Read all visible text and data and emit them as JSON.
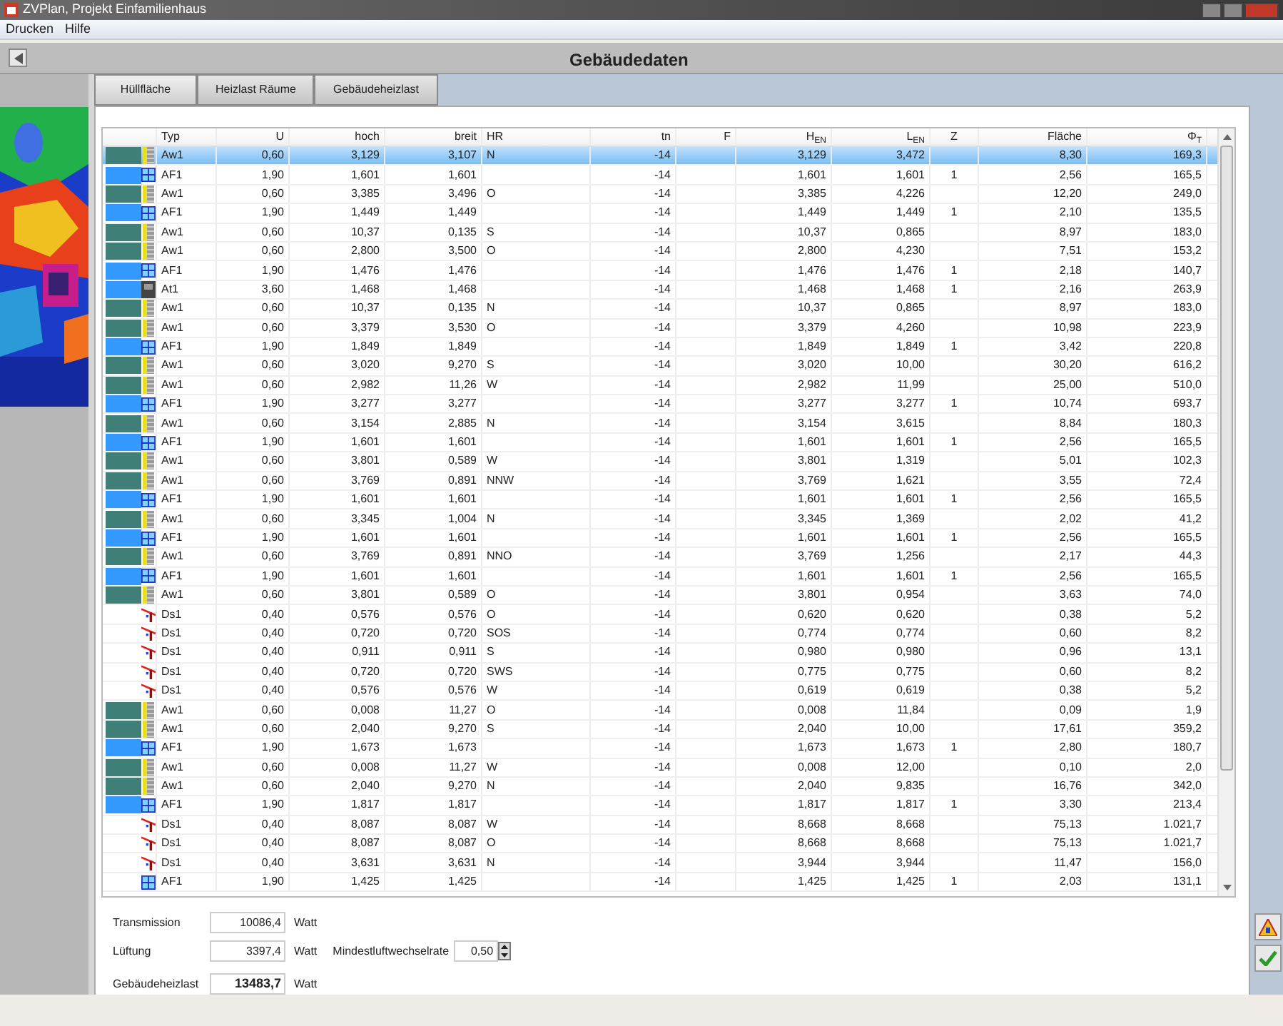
{
  "window": {
    "title": "ZVPlan, Projekt Einfamilienhaus"
  },
  "menu": [
    "Drucken",
    "Hilfe"
  ],
  "header": {
    "title": "Gebäudedaten"
  },
  "sidebar": {
    "picture": {
      "kind": "picture"
    }
  },
  "tabs": [
    {
      "label": "Hüllfläche",
      "selected": true
    },
    {
      "label": "Heizlast Räume",
      "selected": false
    },
    {
      "label": "Gebäudeheizlast",
      "selected": false
    }
  ],
  "table": {
    "columns": [
      "Typ",
      "U",
      "hoch",
      "breit",
      "HR",
      "tn",
      "F",
      "H$_{EN}$",
      "L$_{EN}$",
      "Z",
      "Fläche",
      "Φ$_{T}$"
    ],
    "rows": [
      {
        "kind": "wall",
        "color": "#3f7f78",
        "selected": true,
        "cells": [
          "Aw1",
          "0,60",
          "3,129",
          "3,107",
          "N",
          "-14",
          "",
          "3,129",
          "3,472",
          "",
          "8,30",
          "169,3"
        ]
      },
      {
        "kind": "window",
        "color": "#3399ff",
        "selected": false,
        "cells": [
          "AF1",
          "1,90",
          "1,601",
          "1,601",
          "",
          "-14",
          "",
          "1,601",
          "1,601",
          "1",
          "2,56",
          "165,5"
        ]
      },
      {
        "kind": "wall",
        "color": "#3f7f78",
        "selected": false,
        "cells": [
          "Aw1",
          "0,60",
          "3,385",
          "3,496",
          "O",
          "-14",
          "",
          "3,385",
          "4,226",
          "",
          "12,20",
          "249,0"
        ]
      },
      {
        "kind": "window",
        "color": "#3399ff",
        "selected": false,
        "cells": [
          "AF1",
          "1,90",
          "1,449",
          "1,449",
          "",
          "-14",
          "",
          "1,449",
          "1,449",
          "1",
          "2,10",
          "135,5"
        ]
      },
      {
        "kind": "wall",
        "color": "#3f7f78",
        "selected": false,
        "cells": [
          "Aw1",
          "0,60",
          "10,37",
          "0,135",
          "S",
          "-14",
          "",
          "10,37",
          "0,865",
          "",
          "8,97",
          "183,0"
        ]
      },
      {
        "kind": "wall",
        "color": "#3f7f78",
        "selected": false,
        "cells": [
          "Aw1",
          "0,60",
          "2,800",
          "3,500",
          "O",
          "-14",
          "",
          "2,800",
          "4,230",
          "",
          "7,51",
          "153,2"
        ]
      },
      {
        "kind": "window",
        "color": "#3399ff",
        "selected": false,
        "cells": [
          "AF1",
          "1,90",
          "1,476",
          "1,476",
          "",
          "-14",
          "",
          "1,476",
          "1,476",
          "1",
          "2,18",
          "140,7"
        ]
      },
      {
        "kind": "door",
        "color": "#3399ff",
        "selected": false,
        "cells": [
          "At1",
          "3,60",
          "1,468",
          "1,468",
          "",
          "-14",
          "",
          "1,468",
          "1,468",
          "1",
          "2,16",
          "263,9"
        ]
      },
      {
        "kind": "wall",
        "color": "#3f7f78",
        "selected": false,
        "cells": [
          "Aw1",
          "0,60",
          "10,37",
          "0,135",
          "N",
          "-14",
          "",
          "10,37",
          "0,865",
          "",
          "8,97",
          "183,0"
        ]
      },
      {
        "kind": "wall",
        "color": "#3f7f78",
        "selected": false,
        "cells": [
          "Aw1",
          "0,60",
          "3,379",
          "3,530",
          "O",
          "-14",
          "",
          "3,379",
          "4,260",
          "",
          "10,98",
          "223,9"
        ]
      },
      {
        "kind": "window",
        "color": "#3399ff",
        "selected": false,
        "cells": [
          "AF1",
          "1,90",
          "1,849",
          "1,849",
          "",
          "-14",
          "",
          "1,849",
          "1,849",
          "1",
          "3,42",
          "220,8"
        ]
      },
      {
        "kind": "wall",
        "color": "#3f7f78",
        "selected": false,
        "cells": [
          "Aw1",
          "0,60",
          "3,020",
          "9,270",
          "S",
          "-14",
          "",
          "3,020",
          "10,00",
          "",
          "30,20",
          "616,2"
        ]
      },
      {
        "kind": "wall",
        "color": "#3f7f78",
        "selected": false,
        "cells": [
          "Aw1",
          "0,60",
          "2,982",
          "11,26",
          "W",
          "-14",
          "",
          "2,982",
          "11,99",
          "",
          "25,00",
          "510,0"
        ]
      },
      {
        "kind": "window",
        "color": "#3399ff",
        "selected": false,
        "cells": [
          "AF1",
          "1,90",
          "3,277",
          "3,277",
          "",
          "-14",
          "",
          "3,277",
          "3,277",
          "1",
          "10,74",
          "693,7"
        ]
      },
      {
        "kind": "wall",
        "color": "#3f7f78",
        "selected": false,
        "cells": [
          "Aw1",
          "0,60",
          "3,154",
          "2,885",
          "N",
          "-14",
          "",
          "3,154",
          "3,615",
          "",
          "8,84",
          "180,3"
        ]
      },
      {
        "kind": "window",
        "color": "#3399ff",
        "selected": false,
        "cells": [
          "AF1",
          "1,90",
          "1,601",
          "1,601",
          "",
          "-14",
          "",
          "1,601",
          "1,601",
          "1",
          "2,56",
          "165,5"
        ]
      },
      {
        "kind": "wall",
        "color": "#3f7f78",
        "selected": false,
        "cells": [
          "Aw1",
          "0,60",
          "3,801",
          "0,589",
          "W",
          "-14",
          "",
          "3,801",
          "1,319",
          "",
          "5,01",
          "102,3"
        ]
      },
      {
        "kind": "wall",
        "color": "#3f7f78",
        "selected": false,
        "cells": [
          "Aw1",
          "0,60",
          "3,769",
          "0,891",
          "NNW",
          "-14",
          "",
          "3,769",
          "1,621",
          "",
          "3,55",
          "72,4"
        ]
      },
      {
        "kind": "window",
        "color": "#3399ff",
        "selected": false,
        "cells": [
          "AF1",
          "1,90",
          "1,601",
          "1,601",
          "",
          "-14",
          "",
          "1,601",
          "1,601",
          "1",
          "2,56",
          "165,5"
        ]
      },
      {
        "kind": "wall",
        "color": "#3f7f78",
        "selected": false,
        "cells": [
          "Aw1",
          "0,60",
          "3,345",
          "1,004",
          "N",
          "-14",
          "",
          "3,345",
          "1,369",
          "",
          "2,02",
          "41,2"
        ]
      },
      {
        "kind": "window",
        "color": "#3399ff",
        "selected": false,
        "cells": [
          "AF1",
          "1,90",
          "1,601",
          "1,601",
          "",
          "-14",
          "",
          "1,601",
          "1,601",
          "1",
          "2,56",
          "165,5"
        ]
      },
      {
        "kind": "wall",
        "color": "#3f7f78",
        "selected": false,
        "cells": [
          "Aw1",
          "0,60",
          "3,769",
          "0,891",
          "NNO",
          "-14",
          "",
          "3,769",
          "1,256",
          "",
          "2,17",
          "44,3"
        ]
      },
      {
        "kind": "window",
        "color": "#3399ff",
        "selected": false,
        "cells": [
          "AF1",
          "1,90",
          "1,601",
          "1,601",
          "",
          "-14",
          "",
          "1,601",
          "1,601",
          "1",
          "2,56",
          "165,5"
        ]
      },
      {
        "kind": "wall",
        "color": "#3f7f78",
        "selected": false,
        "cells": [
          "Aw1",
          "0,60",
          "3,801",
          "0,589",
          "O",
          "-14",
          "",
          "3,801",
          "0,954",
          "",
          "3,63",
          "74,0"
        ]
      },
      {
        "kind": "roof",
        "selected": false,
        "cells": [
          "Ds1",
          "0,40",
          "0,576",
          "0,576",
          "O",
          "-14",
          "",
          "0,620",
          "0,620",
          "",
          "0,38",
          "5,2"
        ]
      },
      {
        "kind": "roof",
        "selected": false,
        "cells": [
          "Ds1",
          "0,40",
          "0,720",
          "0,720",
          "SOS",
          "-14",
          "",
          "0,774",
          "0,774",
          "",
          "0,60",
          "8,2"
        ]
      },
      {
        "kind": "roof",
        "selected": false,
        "cells": [
          "Ds1",
          "0,40",
          "0,911",
          "0,911",
          "S",
          "-14",
          "",
          "0,980",
          "0,980",
          "",
          "0,96",
          "13,1"
        ]
      },
      {
        "kind": "roof",
        "selected": false,
        "cells": [
          "Ds1",
          "0,40",
          "0,720",
          "0,720",
          "SWS",
          "-14",
          "",
          "0,775",
          "0,775",
          "",
          "0,60",
          "8,2"
        ]
      },
      {
        "kind": "roof",
        "selected": false,
        "cells": [
          "Ds1",
          "0,40",
          "0,576",
          "0,576",
          "W",
          "-14",
          "",
          "0,619",
          "0,619",
          "",
          "0,38",
          "5,2"
        ]
      },
      {
        "kind": "wall",
        "color": "#3f7f78",
        "selected": false,
        "cells": [
          "Aw1",
          "0,60",
          "0,008",
          "11,27",
          "O",
          "-14",
          "",
          "0,008",
          "11,84",
          "",
          "0,09",
          "1,9"
        ]
      },
      {
        "kind": "wall",
        "color": "#3f7f78",
        "selected": false,
        "cells": [
          "Aw1",
          "0,60",
          "2,040",
          "9,270",
          "S",
          "-14",
          "",
          "2,040",
          "10,00",
          "",
          "17,61",
          "359,2"
        ]
      },
      {
        "kind": "window",
        "color": "#3399ff",
        "selected": false,
        "cells": [
          "AF1",
          "1,90",
          "1,673",
          "1,673",
          "",
          "-14",
          "",
          "1,673",
          "1,673",
          "1",
          "2,80",
          "180,7"
        ]
      },
      {
        "kind": "wall",
        "color": "#3f7f78",
        "selected": false,
        "cells": [
          "Aw1",
          "0,60",
          "0,008",
          "11,27",
          "W",
          "-14",
          "",
          "0,008",
          "12,00",
          "",
          "0,10",
          "2,0"
        ]
      },
      {
        "kind": "wall",
        "color": "#3f7f78",
        "selected": false,
        "cells": [
          "Aw1",
          "0,60",
          "2,040",
          "9,270",
          "N",
          "-14",
          "",
          "2,040",
          "9,835",
          "",
          "16,76",
          "342,0"
        ]
      },
      {
        "kind": "window",
        "color": "#3399ff",
        "selected": false,
        "cells": [
          "AF1",
          "1,90",
          "1,817",
          "1,817",
          "",
          "-14",
          "",
          "1,817",
          "1,817",
          "1",
          "3,30",
          "213,4"
        ]
      },
      {
        "kind": "roof",
        "selected": false,
        "cells": [
          "Ds1",
          "0,40",
          "8,087",
          "8,087",
          "W",
          "-14",
          "",
          "8,668",
          "8,668",
          "",
          "75,13",
          "1.021,7"
        ]
      },
      {
        "kind": "roof",
        "selected": false,
        "cells": [
          "Ds1",
          "0,40",
          "8,087",
          "8,087",
          "O",
          "-14",
          "",
          "8,668",
          "8,668",
          "",
          "75,13",
          "1.021,7"
        ]
      },
      {
        "kind": "roof",
        "selected": false,
        "cells": [
          "Ds1",
          "0,40",
          "3,631",
          "3,631",
          "N",
          "-14",
          "",
          "3,944",
          "3,944",
          "",
          "11,47",
          "156,0"
        ]
      },
      {
        "kind": "window",
        "selected": false,
        "cells": [
          "AF1",
          "1,90",
          "1,425",
          "1,425",
          "",
          "-14",
          "",
          "1,425",
          "1,425",
          "1",
          "2,03",
          "131,1"
        ]
      }
    ]
  },
  "summary": {
    "transmission": {
      "label": "Transmission",
      "value": "10086,4",
      "unit": "Watt"
    },
    "lueftung": {
      "label": "Lüftung",
      "value": "3397,4",
      "unit": "Watt"
    },
    "rate": {
      "label": "Mindestluftwechselrate",
      "value": "0,50"
    },
    "total": {
      "label": "Gebäudeheizlast",
      "value": "13483,7",
      "unit": "Watt"
    }
  }
}
